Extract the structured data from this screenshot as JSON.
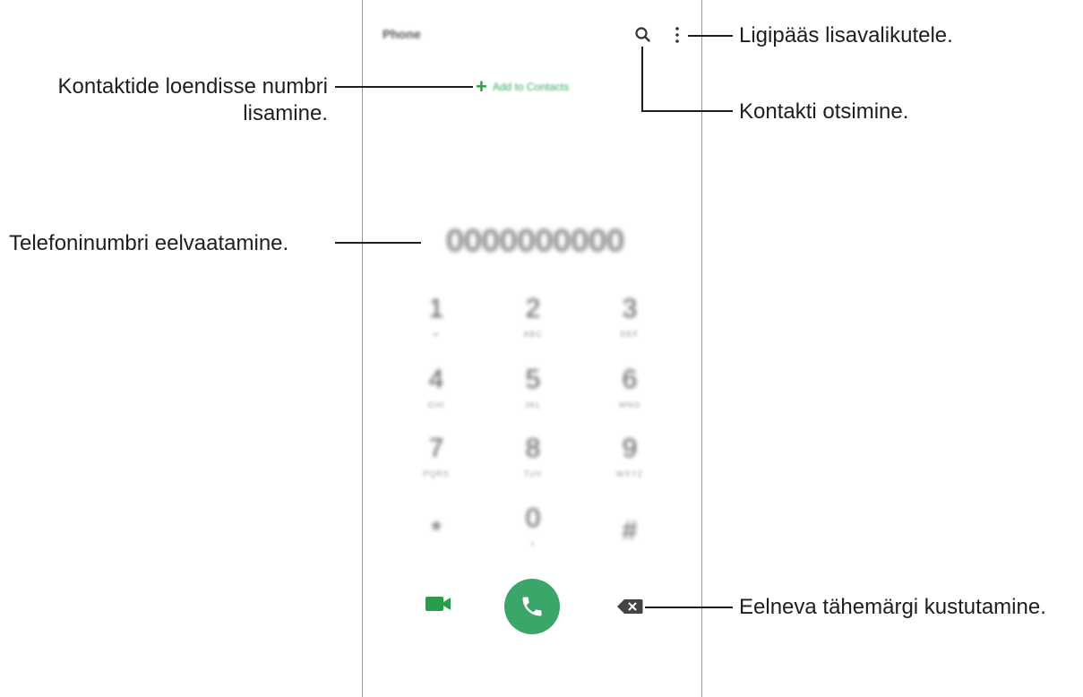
{
  "phone": {
    "app_title": "Phone",
    "add_to_contacts": "Add to Contacts",
    "number_display": "0000000000",
    "keypad": [
      {
        "digit": "1",
        "letters": "∞"
      },
      {
        "digit": "2",
        "letters": "ABC"
      },
      {
        "digit": "3",
        "letters": "DEF"
      },
      {
        "digit": "4",
        "letters": "GHI"
      },
      {
        "digit": "5",
        "letters": "JKL"
      },
      {
        "digit": "6",
        "letters": "MNO"
      },
      {
        "digit": "7",
        "letters": "PQRS"
      },
      {
        "digit": "8",
        "letters": "TUV"
      },
      {
        "digit": "9",
        "letters": "WXYZ"
      },
      {
        "digit": "*",
        "letters": ""
      },
      {
        "digit": "0",
        "letters": "+"
      },
      {
        "digit": "#",
        "letters": ""
      }
    ],
    "icons": {
      "search": "search-icon",
      "more": "more-options-icon",
      "video": "video-call-icon",
      "call": "phone-icon",
      "backspace": "backspace-icon"
    },
    "accent_color": "#3aa66a"
  },
  "annotations": {
    "more_options": "Ligipääs lisavalikutele.",
    "add_to_contacts_line1": "Kontaktide loendisse numbri",
    "add_to_contacts_line2": "lisamine.",
    "search": "Kontakti otsimine.",
    "preview_number": "Telefoninumbri eelvaatamine.",
    "delete_char": "Eelneva tähemärgi kustutamine."
  }
}
